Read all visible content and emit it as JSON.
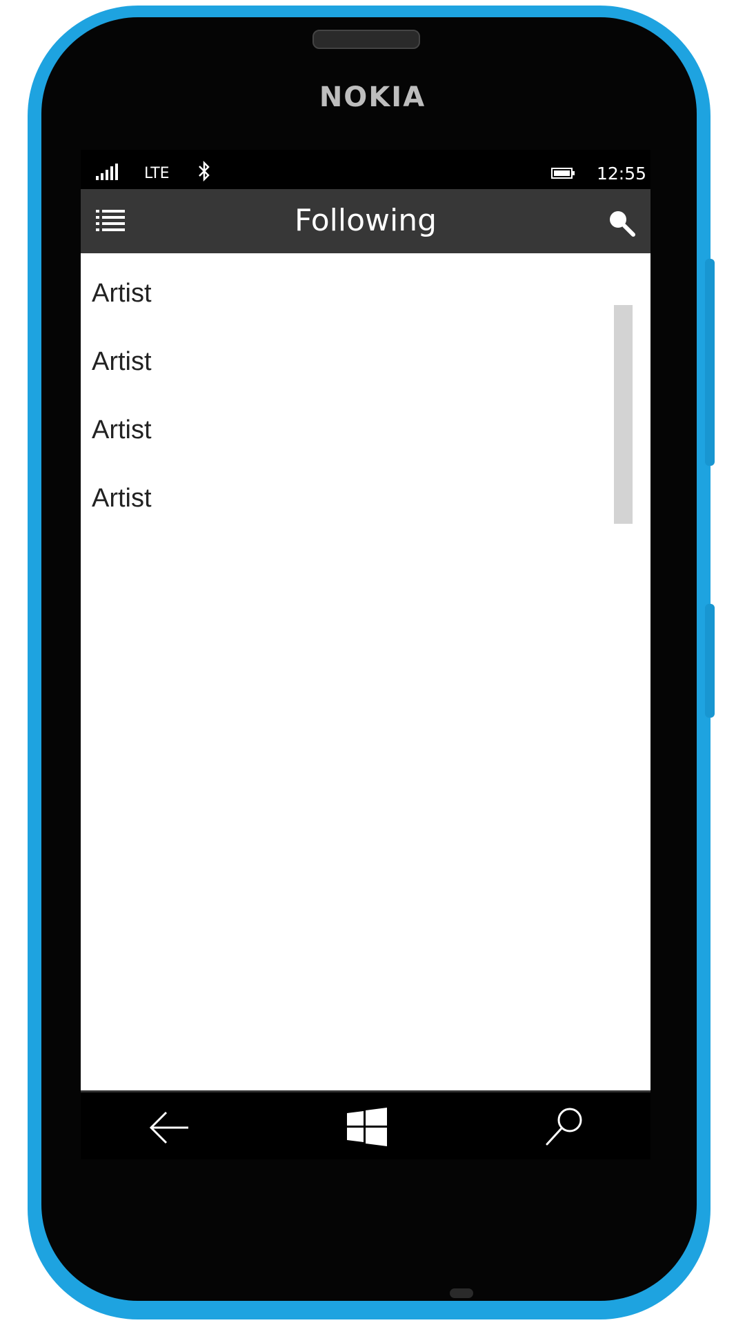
{
  "device": {
    "brand": "NOKIA"
  },
  "status_bar": {
    "network": "LTE",
    "time": "12:55"
  },
  "app_bar": {
    "title": "Following"
  },
  "artists": [
    {
      "label": "Artist"
    },
    {
      "label": "Artist"
    },
    {
      "label": "Artist"
    },
    {
      "label": "Artist"
    }
  ],
  "icons": {
    "signal": "signal-icon",
    "bluetooth": "bluetooth-icon",
    "battery": "battery-icon",
    "menu": "list-menu-icon",
    "search": "search-icon",
    "nav_back": "back-arrow-icon",
    "nav_home": "windows-logo-icon",
    "nav_search": "search-icon"
  },
  "colors": {
    "phone_body": "#1ea3e0",
    "app_bar": "#373737",
    "content_bg": "#ffffff",
    "scrollbar": "#d3d3d3"
  }
}
